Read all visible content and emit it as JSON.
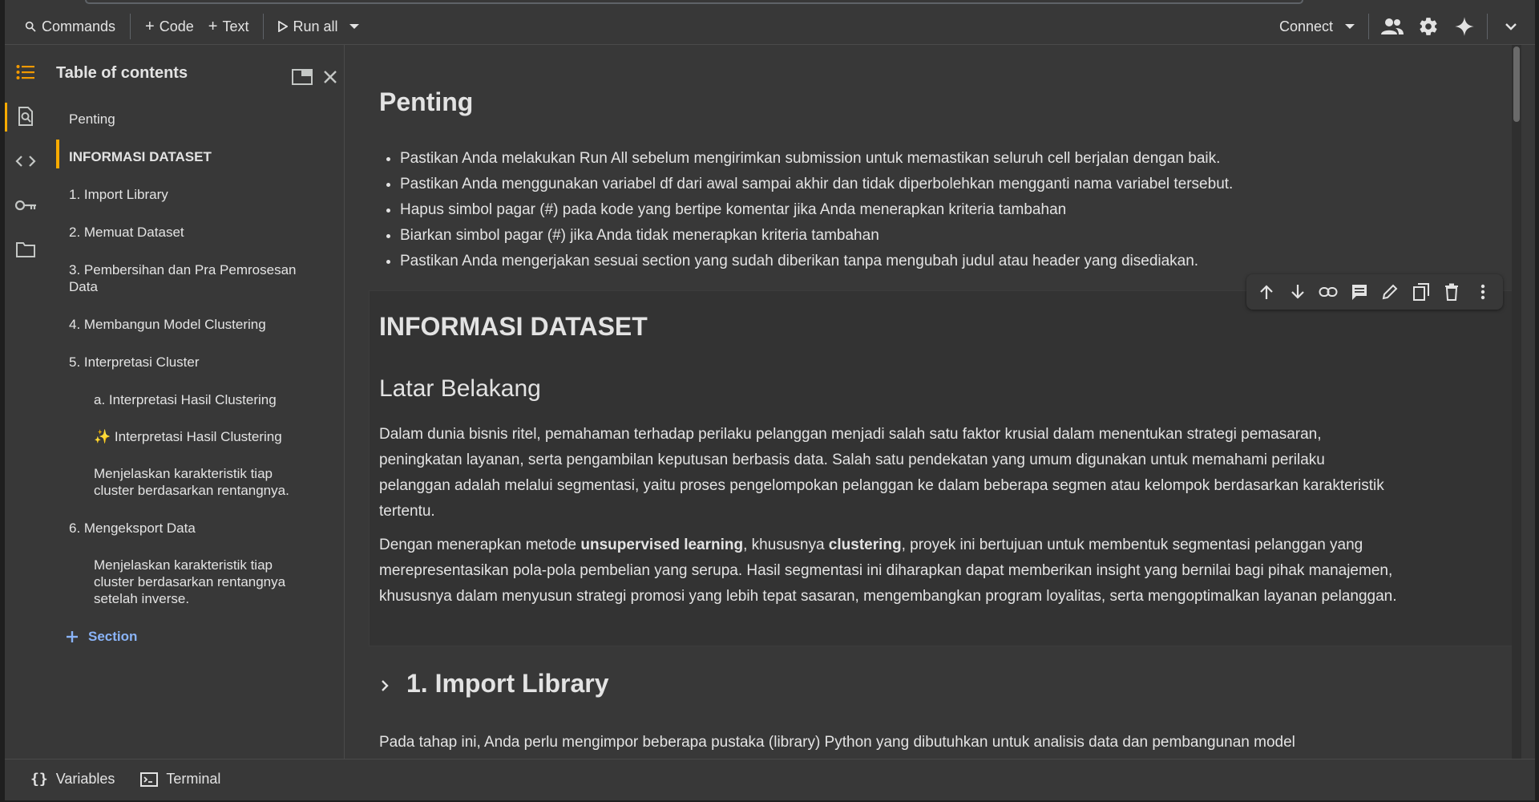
{
  "toolbar": {
    "commands": "Commands",
    "code": "Code",
    "text": "Text",
    "run_all": "Run all",
    "connect": "Connect"
  },
  "toc": {
    "title": "Table of contents",
    "items": [
      {
        "label": "Penting",
        "level": 1,
        "active": false
      },
      {
        "label": "INFORMASI DATASET",
        "level": 1,
        "active": true
      },
      {
        "label": "1. Import Library",
        "level": 1,
        "active": false
      },
      {
        "label": "2. Memuat Dataset",
        "level": 1,
        "active": false
      },
      {
        "label": "3. Pembersihan dan Pra Pemrosesan Data",
        "level": 1,
        "active": false
      },
      {
        "label": "4. Membangun Model Clustering",
        "level": 1,
        "active": false
      },
      {
        "label": "5. Interpretasi Cluster",
        "level": 1,
        "active": false
      },
      {
        "label": "a. Interpretasi Hasil Clustering",
        "level": 2,
        "active": false
      },
      {
        "label": "✨ Interpretasi Hasil Clustering",
        "level": 2,
        "active": false
      },
      {
        "label": "Menjelaskan karakteristik tiap cluster berdasarkan rentangnya.",
        "level": 2,
        "active": false
      },
      {
        "label": "6. Mengeksport Data",
        "level": 1,
        "active": false
      },
      {
        "label": "Menjelaskan karakteristik tiap cluster berdasarkan rentangnya setelah inverse.",
        "level": 2,
        "active": false
      }
    ],
    "add_section": "Section"
  },
  "notebook": {
    "penting_title": "Penting",
    "bullets": [
      "Pastikan Anda melakukan Run All sebelum mengirimkan submission untuk memastikan seluruh cell berjalan dengan baik.",
      "Pastikan Anda menggunakan variabel df dari awal sampai akhir dan tidak diperbolehkan mengganti nama variabel tersebut.",
      "Hapus simbol pagar (#) pada kode yang bertipe komentar jika Anda menerapkan kriteria tambahan",
      "Biarkan simbol pagar (#) jika Anda tidak menerapkan kriteria tambahan",
      "Pastikan Anda mengerjakan sesuai section yang sudah diberikan tanpa mengubah judul atau header yang disediakan."
    ],
    "info_title": "INFORMASI DATASET",
    "latar_title": "Latar Belakang",
    "para1": "Dalam dunia bisnis ritel, pemahaman terhadap perilaku pelanggan menjadi salah satu faktor krusial dalam menentukan strategi pemasaran, peningkatan layanan, serta pengambilan keputusan berbasis data. Salah satu pendekatan yang umum digunakan untuk memahami perilaku pelanggan adalah melalui segmentasi, yaitu proses pengelompokan pelanggan ke dalam beberapa segmen atau kelompok berdasarkan karakteristik tertentu.",
    "para2_a": "Dengan menerapkan metode ",
    "para2_b": "unsupervised learning",
    "para2_c": ", khususnya ",
    "para2_d": "clustering",
    "para2_e": ", proyek ini bertujuan untuk membentuk segmentasi pelanggan yang merepresentasikan pola-pola pembelian yang serupa. Hasil segmentasi ini diharapkan dapat memberikan insight yang bernilai bagi pihak manajemen, khususnya dalam menyusun strategi promosi yang lebih tepat sasaran, mengembangkan program loyalitas, serta mengoptimalkan layanan pelanggan.",
    "import_title": "1. Import Library",
    "import_para": "Pada tahap ini, Anda perlu mengimpor beberapa pustaka (library) Python yang dibutuhkan untuk analisis data dan pembangunan model"
  },
  "statusbar": {
    "variables": "Variables",
    "terminal": "Terminal"
  }
}
